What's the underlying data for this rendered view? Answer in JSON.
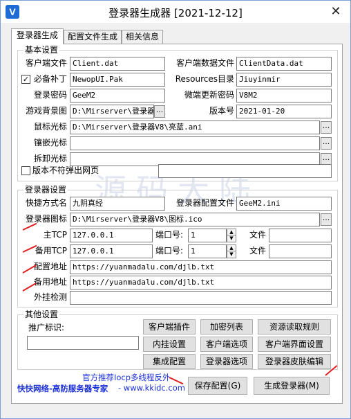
{
  "window": {
    "title": "登录器生成器 [2021-12-12]",
    "close_glyph": "✕",
    "icon_glyph": "V"
  },
  "tabs": [
    {
      "label": "登录器生成"
    },
    {
      "label": "配置文件生成"
    },
    {
      "label": "相关信息"
    }
  ],
  "basic": {
    "title": "基本设置",
    "client_file_label": "客户端文件",
    "client_file_value": "Client.dat",
    "client_data_label": "客户端数据文件",
    "client_data_value": "ClientData.dat",
    "patch_label": "必备补丁",
    "patch_checked": "✓",
    "patch_value": "NewopUI.Pak",
    "resources_label": "Resources目录",
    "resources_value": "Jiuyinmir",
    "password_label": "登录密码",
    "password_value": "GeeM2",
    "micro_pwd_label": "微端更新密码",
    "micro_pwd_value": "V8M2",
    "bg_label": "游戏背景图",
    "bg_value": "D:\\Mirserver\\登录器V8\\",
    "version_label": "版本号",
    "version_value": "2021-01-20",
    "cursor_label": "鼠标光标",
    "cursor_value": "D:\\Mirserver\\登录器V8\\亮蓝.ani",
    "inlay_label": "镶嵌光标",
    "inlay_value": "",
    "detach_label": "拆卸光标",
    "detach_value": "",
    "mismatch_label": "版本不符弹出网页",
    "mismatch_value": "",
    "browse_glyph": "..."
  },
  "launcher": {
    "title": "登录器设置",
    "shortcut_label": "快捷方式名",
    "shortcut_value": "九阴真经",
    "config_label": "登录器配置文件",
    "config_value": "GeeM2.ini",
    "icon_label": "登录器图标",
    "icon_value": "D:\\Mirserver\\登录器V8\\图标.ico",
    "main_tcp_label": "主TCP",
    "main_tcp_value": "127.0.0.1",
    "port_label": "端口号:",
    "main_port_value": "1",
    "file_label": "文件",
    "main_file_value": "",
    "backup_tcp_label": "备用TCP",
    "backup_tcp_value": "127.0.0.1",
    "backup_port_value": "1",
    "backup_file_value": "",
    "config_url_label": "配置地址",
    "config_url_value": "https://yuanmadalu.com/djlb.txt",
    "backup_url_label": "备用地址",
    "backup_url_value": "https://yuanmadalu.com/djlb.txt",
    "cheat_label": "外挂检测",
    "cheat_value": ""
  },
  "other": {
    "title": "其他设置",
    "promo_label": "推广标识:",
    "promo_value": "",
    "buttons": {
      "client_plugin": "客户端插件",
      "encrypt_list": "加密列表",
      "resource_rules": "资源读取规则",
      "inline_settings": "内挂设置",
      "client_options": "客户端选项",
      "client_ui": "客户端界面设置",
      "integration": "集成配置",
      "launcher_options": "登录器选项",
      "launcher_skin": "登录器皮肤编辑"
    }
  },
  "footer": {
    "promo_line1": "官方推荐Iocp多线程反外",
    "promo_line2": "快快网络-高防服务器专家",
    "promo_line3": "- www.kkidc.com",
    "save_button": "保存配置(G)",
    "generate_button": "生成登录器(M)"
  },
  "watermark": "源码大陆",
  "spin_up": "▲",
  "spin_down": "▼"
}
